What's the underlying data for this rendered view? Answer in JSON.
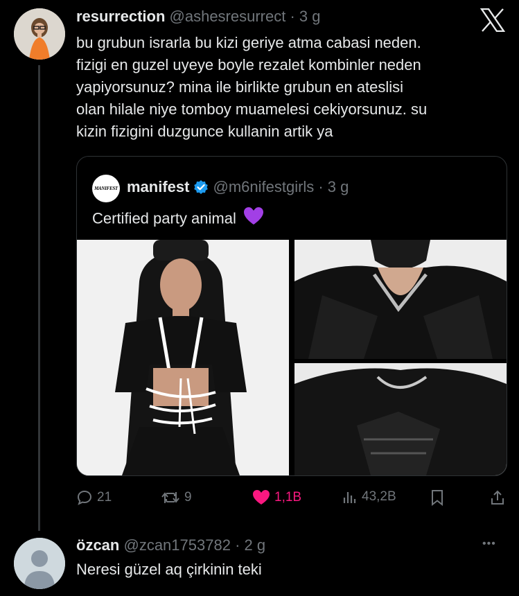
{
  "tweet": {
    "author_name": "resurrection",
    "handle": "@ashesresurrect",
    "time": "· 3 g",
    "lines": [
      "bu grubun israrla bu kizi geriye atma cabasi neden.",
      "fizigi en guzel uyeye boyle rezalet kombinler neden",
      "yapiyorsunuz? mina ile birlikte grubun en ateslisi",
      "olan hilale niye tomboy muamelesi cekiyorsunuz. su",
      "kizin fizigini duzgunce kullanin artik ya"
    ],
    "actions": {
      "replies": "21",
      "retweets": "9",
      "likes": "1,1B",
      "views": "43,2B"
    }
  },
  "quoted": {
    "logo_text": "MANIFEST",
    "author_name": "manifest",
    "handle": "@m6nifestgirls",
    "time": "· 3 g",
    "text": "Certified party animal",
    "emoji": "💜"
  },
  "reply": {
    "author_name": "özcan",
    "handle": "@zcan1753782",
    "time": "· 2 g",
    "text": "Neresi güzel aq çirkinin teki",
    "more": "•••"
  },
  "colors": {
    "background": "#000000",
    "text": "#e7e9ea",
    "muted": "#71767b",
    "like": "#f91880",
    "verified": "#1d9bf0"
  }
}
